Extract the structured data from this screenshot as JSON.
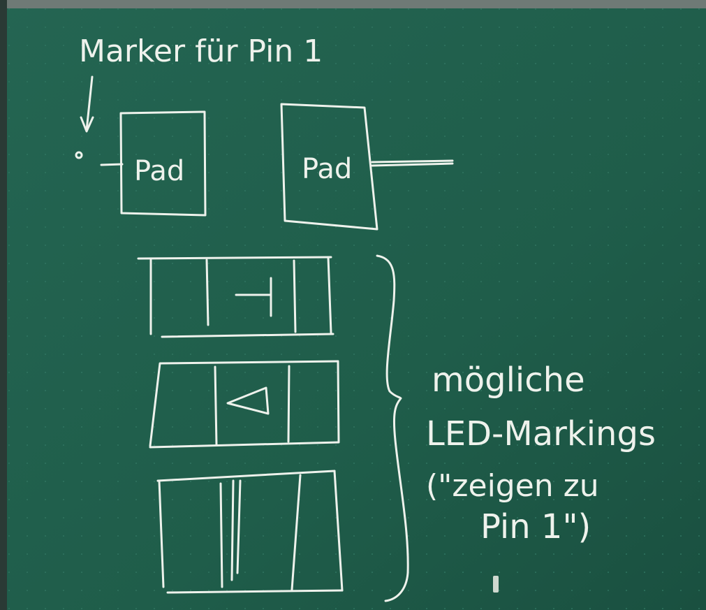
{
  "board": {
    "colors": {
      "board": "#1f5d4a",
      "chalk": "#eef2ec",
      "frame": "#7f8a86"
    }
  },
  "labels": {
    "marker_title": "Marker für Pin 1",
    "pad_left": "Pad",
    "pad_right": "Pad",
    "note_line1": "mögliche",
    "note_line2": "LED-Markings",
    "note_line3": "(\"zeigen zu",
    "note_line4": "Pin 1\")"
  }
}
